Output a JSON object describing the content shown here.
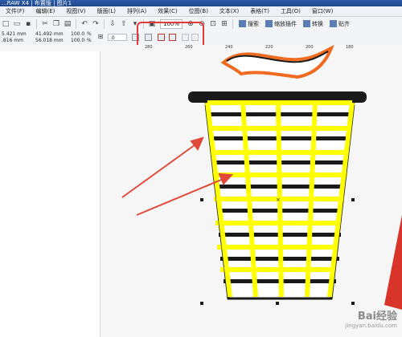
{
  "window": {
    "title": "...RAW X4 | 布置版 | 图片1"
  },
  "menu": {
    "items": [
      "文件(F)",
      "编辑(E)",
      "视图(V)",
      "版面(L)",
      "排列(A)",
      "效果(C)",
      "位图(B)",
      "文本(X)",
      "表格(T)",
      "工具(O)",
      "窗口(W)"
    ]
  },
  "toolbar": {
    "zoom": "100%",
    "buttons": [
      {
        "label": "搜索"
      },
      {
        "label": "缩放插件"
      },
      {
        "label": "转换"
      },
      {
        "label": "贴齐"
      }
    ]
  },
  "propbar": {
    "x": "5.421 mm",
    "y": ".816 mm",
    "w": "41.492 mm",
    "h": "56.018 mm",
    "sx": "100.0",
    "sy": "100.0",
    "pct": "%",
    "rotation": ".0"
  },
  "ruler": {
    "ticks": [
      "280",
      "260",
      "240",
      "220",
      "200",
      "180"
    ]
  },
  "watermark": {
    "text": "Bai经验",
    "sub": "jingyan.baidu.com"
  },
  "colors": {
    "highlight": "#e23a3a",
    "arrow": "#e0483a",
    "grid": "#ffff00",
    "dark": "#1a1a1a"
  }
}
